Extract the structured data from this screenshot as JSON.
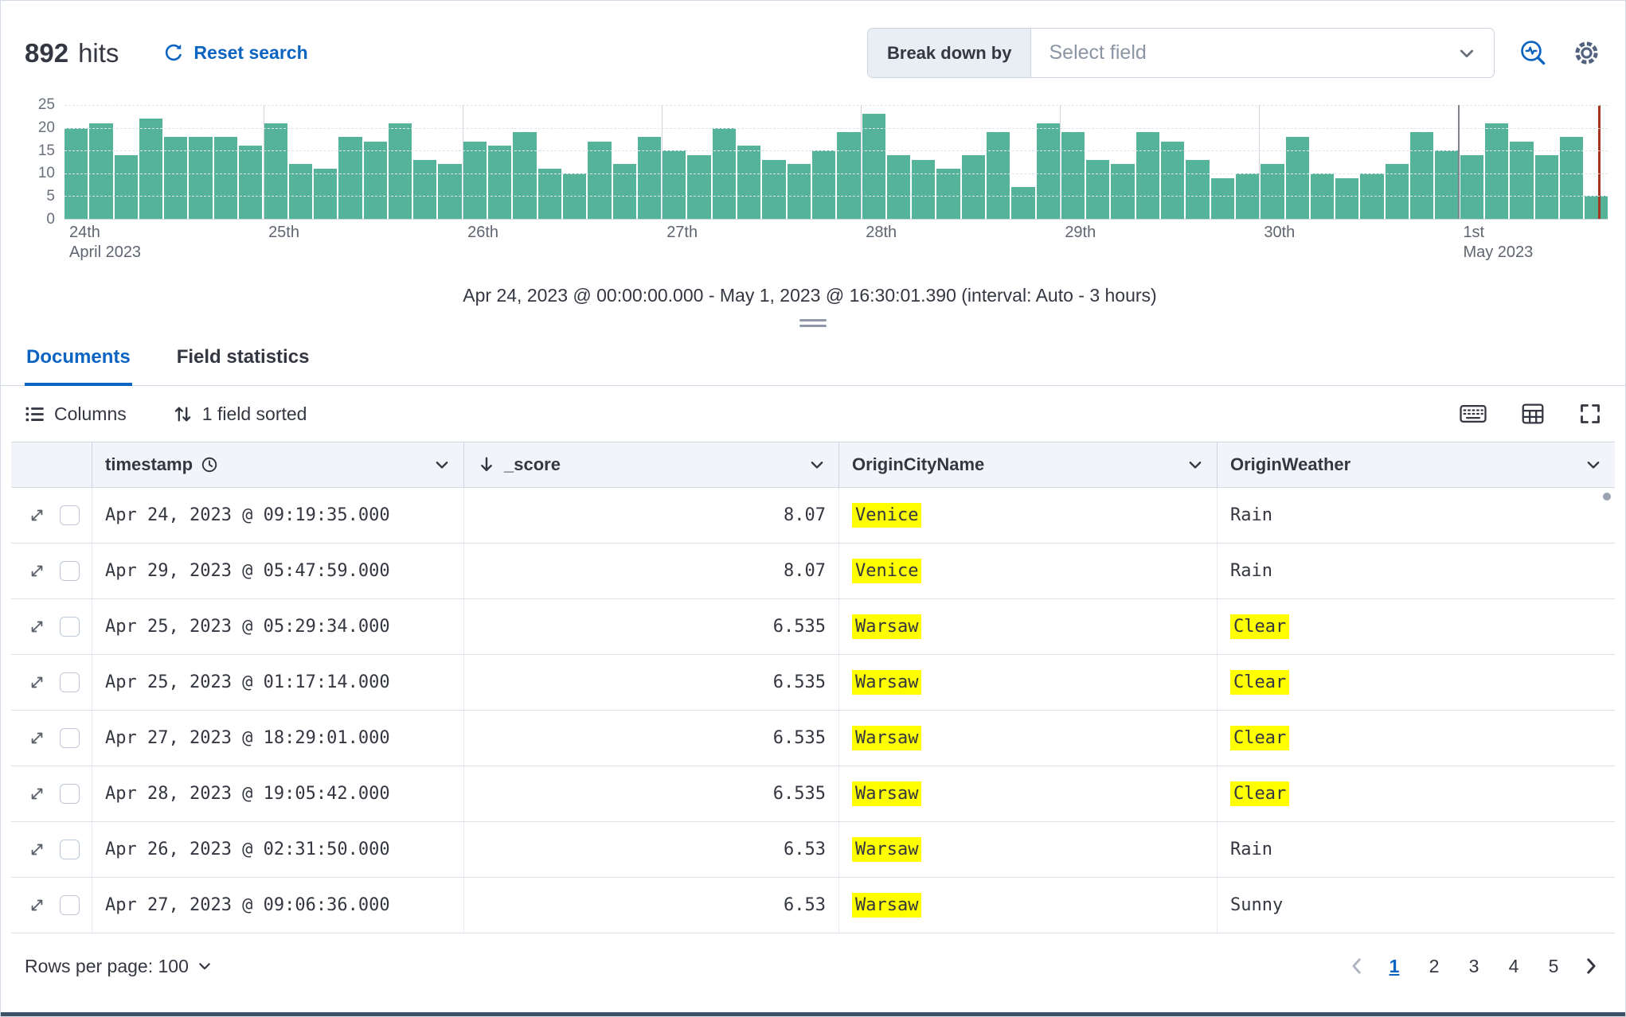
{
  "header": {
    "hits_count": "892",
    "hits_label": "hits",
    "reset_search_label": "Reset search",
    "breakdown_label": "Break down by",
    "breakdown_placeholder": "Select field"
  },
  "chart_data": {
    "type": "bar",
    "title": "",
    "xlabel": "",
    "ylabel": "",
    "ylim": [
      0,
      25
    ],
    "y_ticks": [
      0,
      5,
      10,
      15,
      20,
      25
    ],
    "grid": true,
    "bar_color": "#54b399",
    "interval": "3 hours",
    "values": [
      20,
      21,
      14,
      22,
      18,
      18,
      18,
      16,
      21,
      12,
      11,
      18,
      17,
      21,
      13,
      12,
      17,
      16,
      19,
      11,
      10,
      17,
      12,
      18,
      15,
      14,
      20,
      16,
      13,
      12,
      15,
      19,
      23,
      14,
      13,
      11,
      14,
      19,
      7,
      21,
      19,
      13,
      12,
      19,
      17,
      13,
      9,
      10,
      12,
      18,
      10,
      9,
      10,
      12,
      19,
      15,
      14,
      21,
      17,
      14,
      18,
      5
    ],
    "x_ticks": [
      {
        "label": "24th",
        "sublabel": "April 2023",
        "bar": 0
      },
      {
        "label": "25th",
        "bar": 8
      },
      {
        "label": "26th",
        "bar": 16
      },
      {
        "label": "27th",
        "bar": 24
      },
      {
        "label": "28th",
        "bar": 32
      },
      {
        "label": "29th",
        "bar": 40
      },
      {
        "label": "30th",
        "bar": 48
      },
      {
        "label": "1st",
        "sublabel": "May 2023",
        "bar": 56,
        "strong": true
      }
    ],
    "caption": "Apr 24, 2023 @ 00:00:00.000 - May 1, 2023 @ 16:30:01.390 (interval: Auto - 3 hours)",
    "now_marker_color": "#a43522"
  },
  "tabs": {
    "documents": "Documents",
    "field_statistics": "Field statistics"
  },
  "toolbar": {
    "columns_label": "Columns",
    "sorted_label": "1 field sorted"
  },
  "table": {
    "columns": [
      {
        "label": "timestamp"
      },
      {
        "label": "_score"
      },
      {
        "label": "OriginCityName"
      },
      {
        "label": "OriginWeather"
      }
    ],
    "highlight_color": "#ffff00",
    "rows": [
      {
        "timestamp": "Apr 24, 2023 @ 09:19:35.000",
        "score": "8.07",
        "city": "Venice",
        "city_hl": true,
        "weather": "Rain",
        "weather_hl": false
      },
      {
        "timestamp": "Apr 29, 2023 @ 05:47:59.000",
        "score": "8.07",
        "city": "Venice",
        "city_hl": true,
        "weather": "Rain",
        "weather_hl": false
      },
      {
        "timestamp": "Apr 25, 2023 @ 05:29:34.000",
        "score": "6.535",
        "city": "Warsaw",
        "city_hl": true,
        "weather": "Clear",
        "weather_hl": true
      },
      {
        "timestamp": "Apr 25, 2023 @ 01:17:14.000",
        "score": "6.535",
        "city": "Warsaw",
        "city_hl": true,
        "weather": "Clear",
        "weather_hl": true
      },
      {
        "timestamp": "Apr 27, 2023 @ 18:29:01.000",
        "score": "6.535",
        "city": "Warsaw",
        "city_hl": true,
        "weather": "Clear",
        "weather_hl": true
      },
      {
        "timestamp": "Apr 28, 2023 @ 19:05:42.000",
        "score": "6.535",
        "city": "Warsaw",
        "city_hl": true,
        "weather": "Clear",
        "weather_hl": true
      },
      {
        "timestamp": "Apr 26, 2023 @ 02:31:50.000",
        "score": "6.53",
        "city": "Warsaw",
        "city_hl": true,
        "weather": "Rain",
        "weather_hl": false
      },
      {
        "timestamp": "Apr 27, 2023 @ 09:06:36.000",
        "score": "6.53",
        "city": "Warsaw",
        "city_hl": true,
        "weather": "Sunny",
        "weather_hl": false
      }
    ]
  },
  "footer": {
    "rows_per_page_label": "Rows per page: 100",
    "pages": [
      "1",
      "2",
      "3",
      "4",
      "5"
    ],
    "active_page": "1"
  },
  "colors": {
    "accent_blue": "#0b64c2",
    "bar_green": "#54b399",
    "highlight_yellow": "#ffff00"
  }
}
